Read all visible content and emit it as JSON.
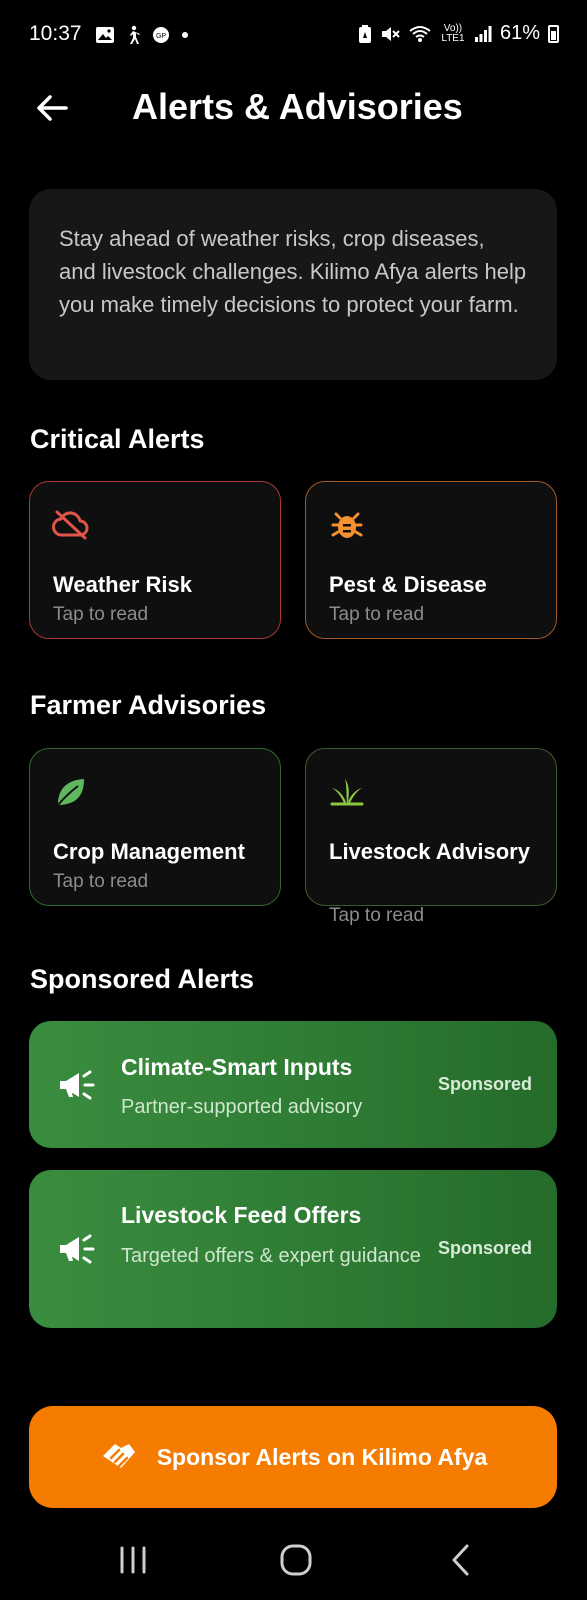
{
  "status_bar": {
    "time": "10:37",
    "battery": "61%",
    "left_icons": [
      "gallery-icon",
      "walking-icon",
      "app-icon",
      "dot"
    ],
    "right_icons": [
      "battery-saver-icon",
      "mute-icon",
      "wifi-icon",
      "volte-icon",
      "signal-icon"
    ],
    "volte_label": "Vo)) LTE1"
  },
  "header": {
    "title": "Alerts & Advisories"
  },
  "intro": {
    "text": "Stay ahead of weather risks, crop diseases, and livestock challenges. Kilimo Afya alerts help you make timely decisions to protect your farm."
  },
  "critical": {
    "title": "Critical Alerts",
    "items": [
      {
        "label": "Weather Risk",
        "sub": "Tap to read",
        "icon": "cloud-off-icon",
        "color": "#e05548"
      },
      {
        "label": "Pest & Disease",
        "sub": "Tap to read",
        "icon": "bug-icon",
        "color": "#f5922f"
      }
    ]
  },
  "advisories": {
    "title": "Farmer Advisories",
    "items": [
      {
        "label": "Crop Management",
        "sub": "Tap to read",
        "icon": "leaf-icon",
        "color": "#5fb85f"
      },
      {
        "label": "Livestock Advisory",
        "sub": "Tap to read",
        "icon": "grass-icon",
        "color": "#8dc63f"
      }
    ]
  },
  "sponsored": {
    "title": "Sponsored Alerts",
    "items": [
      {
        "title": "Climate-Smart Inputs",
        "sub": "Partner-supported advisory",
        "tag": "Sponsored",
        "icon": "megaphone-icon"
      },
      {
        "title": "Livestock Feed Offers",
        "sub": "Targeted offers & expert guidance",
        "tag": "Sponsored",
        "icon": "megaphone-icon"
      }
    ]
  },
  "cta": {
    "label": "Sponsor Alerts on Kilimo Afya",
    "icon": "handshake-icon",
    "color": "#f57c00"
  },
  "nav": {
    "items": [
      "recents-icon",
      "home-icon",
      "back-nav-icon"
    ]
  }
}
